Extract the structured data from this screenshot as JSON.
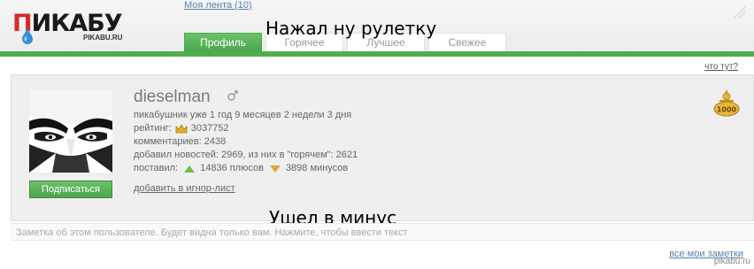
{
  "header": {
    "logo_text_red": "П",
    "logo_text_dark": "ИКАБУ",
    "logo_sub": "PIKABU.RU",
    "my_feed_link": "Моя лента (10)",
    "tabs": [
      {
        "label": "Профиль",
        "active": true
      },
      {
        "label": "Горячее",
        "active": false
      },
      {
        "label": "Лучшее",
        "active": false
      },
      {
        "label": "Свежее",
        "active": false
      }
    ]
  },
  "captions": {
    "top": "Нажал ну рулетку",
    "bottom": "Ушел в минус"
  },
  "what_link": "что тут?",
  "profile": {
    "username": "dieselman",
    "member_since": "пикабушник уже 1 год 9 месяцев 2 недели 3 дня",
    "rating_label": "рейтинг:",
    "rating_value": "3037752",
    "comments": "комментариев: 2438",
    "news": "добавил новостей: 2969, из них в \"горячем\": 2621",
    "votes_label": "поставил:",
    "pluses": "14836 плюсов",
    "minuses": "3898 минусов",
    "subscribe_label": "Подписаться",
    "ignore_link": "добавить в игнор-лист",
    "medal_value": "1000"
  },
  "note_placeholder": "Заметка об этом пользователе. Будет видна только вам. Нажмите, чтобы ввести текст",
  "my_notes_link": "все мои заметки",
  "watermark": "pikabu.ru",
  "colors": {
    "accent_green": "#4fad4f",
    "rating_crown": "#e0b02a",
    "plus_arrow": "#6cc04a",
    "minus_arrow": "#e3a52b"
  }
}
